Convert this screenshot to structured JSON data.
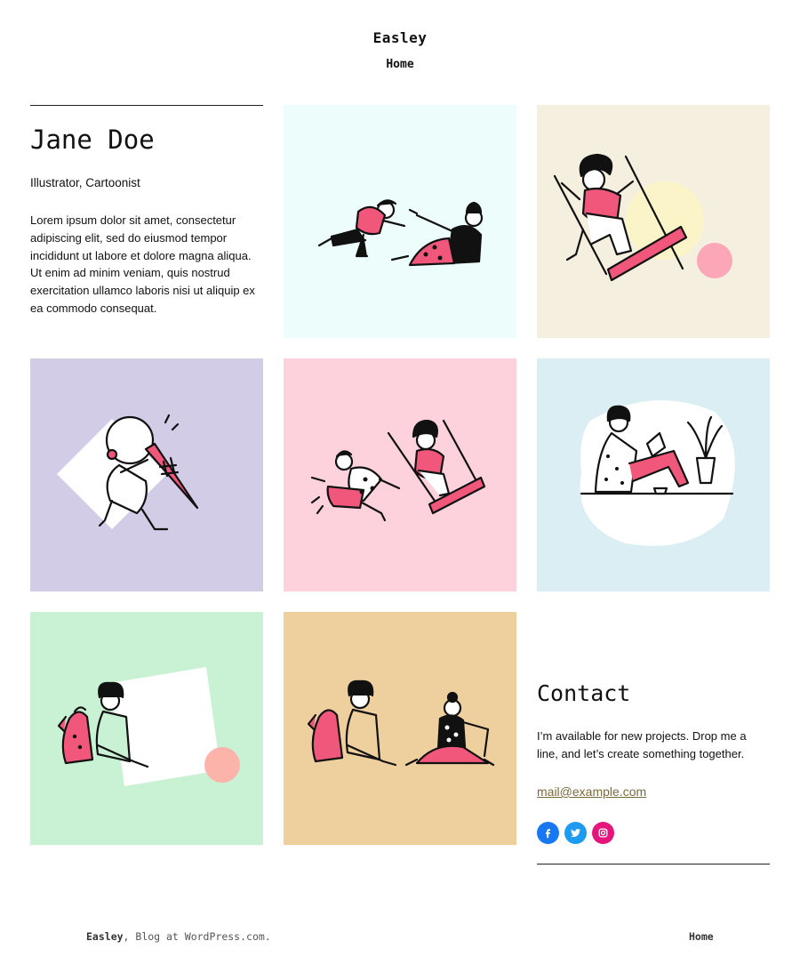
{
  "header": {
    "site_title": "Easley",
    "nav": [
      "Home"
    ]
  },
  "intro": {
    "name": "Jane Doe",
    "role": "Illustrator, Cartoonist",
    "bio": "Lorem ipsum dolor sit amet, consectetur adipiscing elit, sed do eiusmod tempor incididunt ut labore et dolore magna aliqua. Ut enim ad minim veniam, quis nostrud exercitation ullamco laboris nisi ut aliquip ex ea commodo consequat."
  },
  "gallery": [
    {
      "subject": "two-figures-sliding",
      "background": "#edfdfb"
    },
    {
      "subject": "woman-on-swing",
      "background": "#f5efe0"
    },
    {
      "subject": "figure-with-ice-cream",
      "background": "#d2cce6"
    },
    {
      "subject": "swing-and-runner",
      "background": "#fdd2dc"
    },
    {
      "subject": "woman-reading-with-plant",
      "background": "#dbeef3"
    },
    {
      "subject": "woman-with-dog",
      "background": "#c9f2d4"
    },
    {
      "subject": "friends-with-dog",
      "background": "#eecf9e"
    }
  ],
  "contact": {
    "title": "Contact",
    "text": "I’m available for new projects. Drop me a line, and let’s create something together.",
    "email": "mail@example.com",
    "social": [
      {
        "name": "facebook",
        "color": "#1877f2"
      },
      {
        "name": "twitter",
        "color": "#1d9bf0"
      },
      {
        "name": "instagram",
        "color": "#e4167c"
      }
    ]
  },
  "footer": {
    "site": "Easley",
    "credit": ", Blog at WordPress.com.",
    "nav": "Home"
  },
  "colors": {
    "accent_pink": "#f0577a",
    "ink": "#111111",
    "link": "#7a6a3c"
  }
}
